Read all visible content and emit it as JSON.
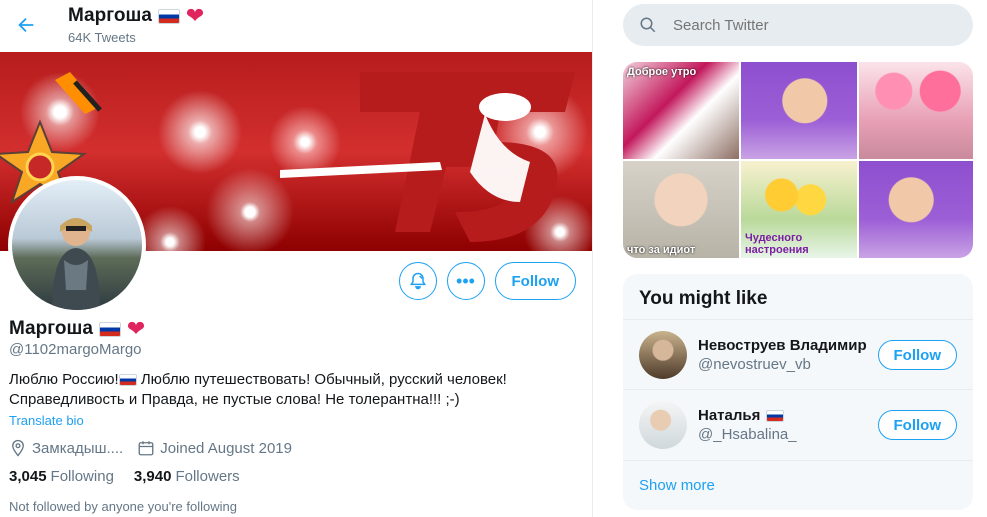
{
  "header": {
    "name": "Маргоша",
    "tweet_count": "64K Tweets"
  },
  "profile": {
    "name": "Маргоша",
    "handle": "@1102margoMargo",
    "bio_line1_a": "Люблю Россию!",
    "bio_line1_b": " Люблю путешествовать!  Обычный, русский человек!",
    "bio_line2": "Справедливость и Правда, не пустые слова! Не толерантна!!! ;-)",
    "translate_label": "Translate bio",
    "location": "Замкадыш....",
    "joined": "Joined August 2019",
    "following_count": "3,045",
    "following_label": "Following",
    "followers_count": "3,940",
    "followers_label": "Followers",
    "not_followed_text": "Not followed by anyone you're following",
    "follow_label": "Follow",
    "banner_number": "75"
  },
  "search": {
    "placeholder": "Search Twitter"
  },
  "media": {
    "tiles": [
      {
        "caption": "Доброе утро"
      },
      {
        "caption": ""
      },
      {
        "caption": ""
      },
      {
        "caption": "что за идиот"
      },
      {
        "caption": "Чудесного настроения"
      },
      {
        "caption": ""
      }
    ]
  },
  "who_to_follow": {
    "title": "You might like",
    "users": [
      {
        "name": "Невоструев Владимир",
        "handle": "@nevostruev_vb",
        "follow_label": "Follow"
      },
      {
        "name": "Наталья",
        "handle": "@_Hsabalina_",
        "follow_label": "Follow"
      }
    ],
    "show_more": "Show more"
  },
  "colors": {
    "accent": "#1da1f2",
    "heart": "#e0245e",
    "banner_red": "#d32f2f"
  },
  "icons": [
    "back-arrow-icon",
    "heart-icon",
    "flag-russia-icon",
    "search-icon",
    "location-icon",
    "calendar-icon",
    "notification-bell-icon",
    "more-icon"
  ]
}
